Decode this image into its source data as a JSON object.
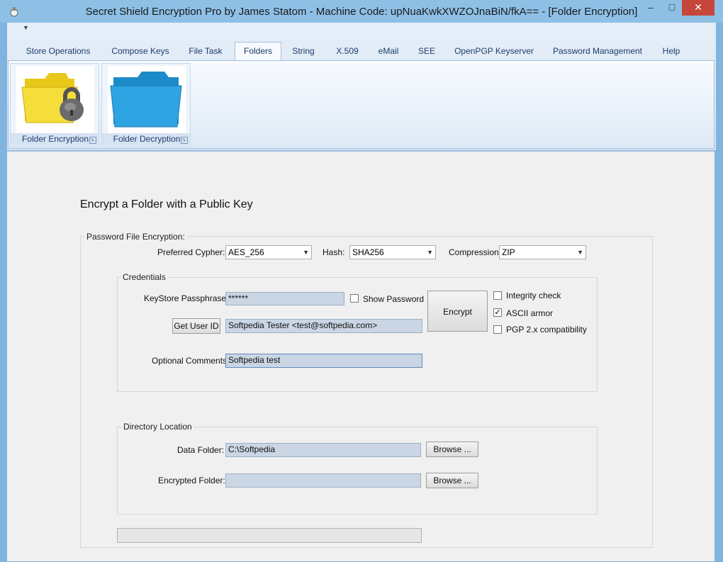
{
  "window": {
    "title": "Secret Shield Encryption Pro by James Statom - Machine Code: upNuaKwkXWZOJnaBiN/fkA== - [Folder Encryption]",
    "minimize": "–",
    "maximize": "□",
    "close": "✕"
  },
  "ribbon": {
    "tabs": [
      "Store Operations",
      "Compose Keys",
      "File Task",
      "Folders",
      "String",
      "X.509",
      "eMail",
      "SEE",
      "OpenPGP Keyserver",
      "Password Management",
      "Help"
    ],
    "active_tab": "Folders",
    "groups": [
      {
        "label": "Folder Encryption",
        "icon": "folder-lock-icon"
      },
      {
        "label": "Folder Decryption",
        "icon": "folder-blue-icon"
      }
    ]
  },
  "form": {
    "heading": "Encrypt a Folder with a Public Key",
    "password_section": {
      "legend": "Password File Encryption:",
      "cypher_label": "Preferred  Cypher:",
      "cypher_value": "AES_256",
      "hash_label": "Hash:",
      "hash_value": "SHA256",
      "compression_label": "Compression",
      "compression_value": "ZIP"
    },
    "credentials": {
      "legend": "Credentials",
      "passphrase_label": "KeyStore Passphrase:",
      "passphrase_value": "******",
      "show_password_label": "Show Password",
      "show_password_checked": false,
      "get_user_id_label": "Get User ID",
      "user_id_value": "Softpedia Tester <test@softpedia.com>",
      "comments_label": "Optional Comments:",
      "comments_value": "Softpedia test",
      "encrypt_label": "Encrypt",
      "options": [
        {
          "label": "Integrity check",
          "checked": false
        },
        {
          "label": "ASCII armor",
          "checked": true
        },
        {
          "label": "PGP 2.x compatibility",
          "checked": false
        }
      ]
    },
    "directory": {
      "legend": "Directory Location",
      "data_folder_label": "Data Folder:",
      "data_folder_value": "C:\\Softpedia",
      "encrypted_folder_label": "Encrypted Folder:",
      "encrypted_folder_value": "",
      "browse_label": "Browse ..."
    },
    "progress": 0
  }
}
